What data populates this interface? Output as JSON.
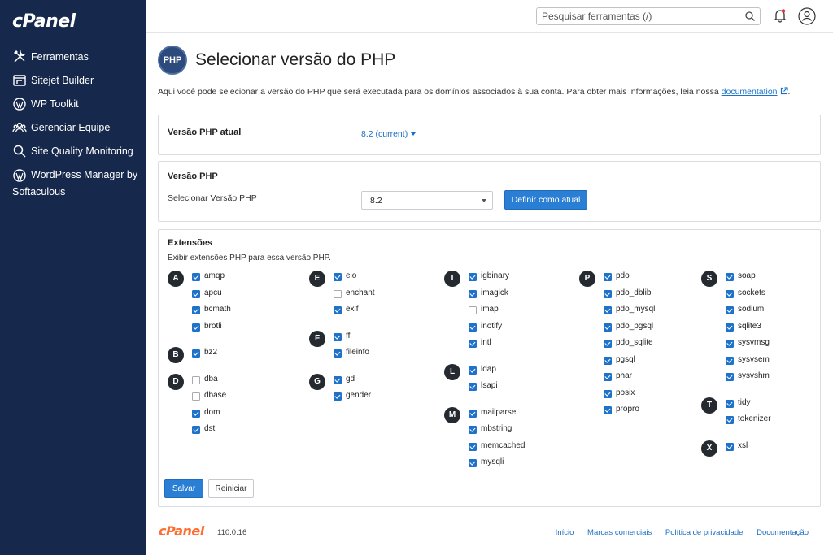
{
  "brand": "cPanel",
  "sidebar": {
    "items": [
      {
        "label": "Ferramentas",
        "icon": "tools-icon"
      },
      {
        "label": "Sitejet Builder",
        "icon": "sitejet-icon"
      },
      {
        "label": "WP Toolkit",
        "icon": "wordpress-icon"
      },
      {
        "label": "Gerenciar Equipe",
        "icon": "team-icon"
      },
      {
        "label": "Site Quality Monitoring",
        "icon": "search-icon"
      },
      {
        "label": "WordPress Manager by Softaculous",
        "icon": "wordpress-icon"
      }
    ]
  },
  "header": {
    "search_placeholder": "Pesquisar ferramentas (/)",
    "notification_color": "#e53935"
  },
  "page": {
    "logo_text": "PHP",
    "title": "Selecionar versão do PHP",
    "intro": "Aqui você pode selecionar a versão do PHP que será executada para os domínios associados à sua conta. Para obter mais informações, leia nossa ",
    "intro_link": "documentation",
    "intro_end": "."
  },
  "current_panel": {
    "label": "Versão PHP atual",
    "value": "8.2 (current)"
  },
  "version_panel": {
    "heading": "Versão PHP",
    "select_label": "Selecionar Versão PHP",
    "selected": "8.2",
    "set_button": "Definir como atual"
  },
  "extensions": {
    "heading": "Extensões",
    "subtitle": "Exibir extensões PHP para essa versão PHP.",
    "columns": [
      [
        {
          "letter": "A",
          "items": [
            {
              "name": "amqp",
              "checked": true
            },
            {
              "name": "apcu",
              "checked": true
            },
            {
              "name": "bcmath",
              "checked": true
            },
            {
              "name": "brotli",
              "checked": true
            }
          ]
        },
        {
          "letter": "B",
          "items": [
            {
              "name": "bz2",
              "checked": true
            }
          ]
        },
        {
          "letter": "D",
          "items": [
            {
              "name": "dba",
              "checked": false
            },
            {
              "name": "dbase",
              "checked": false
            },
            {
              "name": "dom",
              "checked": true
            },
            {
              "name": "dsti",
              "checked": true
            }
          ]
        }
      ],
      [
        {
          "letter": "E",
          "items": [
            {
              "name": "eio",
              "checked": true
            },
            {
              "name": "enchant",
              "checked": false
            },
            {
              "name": "exif",
              "checked": true
            }
          ]
        },
        {
          "letter": "F",
          "items": [
            {
              "name": "ffi",
              "checked": true
            },
            {
              "name": "fileinfo",
              "checked": true
            }
          ]
        },
        {
          "letter": "G",
          "items": [
            {
              "name": "gd",
              "checked": true
            },
            {
              "name": "gender",
              "checked": true
            }
          ]
        }
      ],
      [
        {
          "letter": "I",
          "items": [
            {
              "name": "igbinary",
              "checked": true
            },
            {
              "name": "imagick",
              "checked": true
            },
            {
              "name": "imap",
              "checked": false
            },
            {
              "name": "inotify",
              "checked": true
            },
            {
              "name": "intl",
              "checked": true
            }
          ]
        },
        {
          "letter": "L",
          "items": [
            {
              "name": "ldap",
              "checked": true
            },
            {
              "name": "lsapi",
              "checked": true
            }
          ]
        },
        {
          "letter": "M",
          "items": [
            {
              "name": "mailparse",
              "checked": true
            },
            {
              "name": "mbstring",
              "checked": true
            },
            {
              "name": "memcached",
              "checked": true
            },
            {
              "name": "mysqli",
              "checked": true
            }
          ]
        }
      ],
      [
        {
          "letter": "P",
          "items": [
            {
              "name": "pdo",
              "checked": true
            },
            {
              "name": "pdo_dblib",
              "checked": true
            },
            {
              "name": "pdo_mysql",
              "checked": true
            },
            {
              "name": "pdo_pgsql",
              "checked": true
            },
            {
              "name": "pdo_sqlite",
              "checked": true
            },
            {
              "name": "pgsql",
              "checked": true
            },
            {
              "name": "phar",
              "checked": true
            },
            {
              "name": "posix",
              "checked": true
            },
            {
              "name": "propro",
              "checked": true
            }
          ]
        }
      ],
      [
        {
          "letter": "S",
          "items": [
            {
              "name": "soap",
              "checked": true
            },
            {
              "name": "sockets",
              "checked": true
            },
            {
              "name": "sodium",
              "checked": true
            },
            {
              "name": "sqlite3",
              "checked": true
            },
            {
              "name": "sysvmsg",
              "checked": true
            },
            {
              "name": "sysvsem",
              "checked": true
            },
            {
              "name": "sysvshm",
              "checked": true
            }
          ]
        },
        {
          "letter": "T",
          "items": [
            {
              "name": "tidy",
              "checked": true
            },
            {
              "name": "tokenizer",
              "checked": true
            }
          ]
        },
        {
          "letter": "X",
          "items": [
            {
              "name": "xsl",
              "checked": true
            }
          ]
        }
      ]
    ],
    "save_button": "Salvar",
    "reset_button": "Reiniciar"
  },
  "footer": {
    "brand": "cPanel",
    "version": "110.0.16",
    "links": [
      "Início",
      "Marcas comerciais",
      "Política de privacidade",
      "Documentação"
    ]
  }
}
